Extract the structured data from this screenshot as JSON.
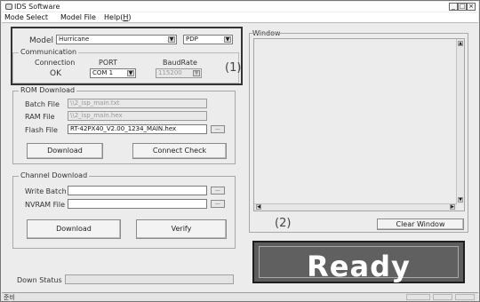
{
  "window": {
    "title": "IDS Software",
    "min_label": "_",
    "max_label": "□",
    "close_label": "×"
  },
  "menu": {
    "items": [
      {
        "prefix": "Mode Select",
        "accel": "",
        "suffix": ""
      },
      {
        "prefix": "Model File",
        "accel": "",
        "suffix": ""
      },
      {
        "prefix": "Help(",
        "accel": "H",
        "suffix": ")"
      }
    ]
  },
  "model": {
    "label": "Model",
    "value": "Hurricane",
    "panel_type": "PDP"
  },
  "communication": {
    "legend": "Communication",
    "connection_header": "Connection",
    "connection_value": "OK",
    "port_header": "PORT",
    "port_value": "COM 1",
    "baud_header": "BaudRate",
    "baud_value": "115200"
  },
  "annotations": {
    "one": "(1)",
    "two": "(2)"
  },
  "rom_download": {
    "legend": "ROM Download",
    "batch_label": "Batch File",
    "batch_value": "\\\\2_isp_main.txt",
    "ram_label": "RAM File",
    "ram_value": "\\\\2_isp_main.hex",
    "flash_label": "Flash File",
    "flash_value": "RT-42PX40_V2.00_1234_MAIN.hex",
    "browse_label": "...",
    "download_label": "Download",
    "connect_check_label": "Connect Check"
  },
  "channel_download": {
    "legend": "Channel Download",
    "write_batch_label": "Write Batch",
    "write_batch_value": "",
    "nvram_label": "NVRAM File",
    "nvram_value": "",
    "browse_label": "...",
    "download_label": "Download",
    "verify_label": "Verify"
  },
  "output_window": {
    "label": "Window",
    "clear_label": "Clear Window"
  },
  "ready": {
    "text": "Ready"
  },
  "down_status": {
    "label": "Down Status"
  },
  "statusbar": {
    "text": "준비"
  }
}
